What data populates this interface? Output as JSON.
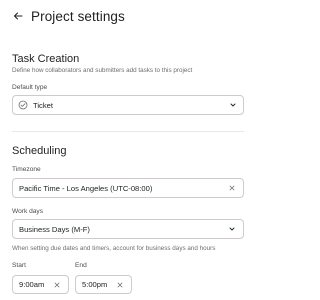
{
  "header": {
    "title": "Project settings"
  },
  "task_creation": {
    "title": "Task Creation",
    "description": "Define how collaborators and submitters add tasks to this project",
    "default_type_label": "Default type",
    "default_type_value": "Ticket"
  },
  "scheduling": {
    "title": "Scheduling",
    "timezone_label": "Timezone",
    "timezone_value": "Pacific Time - Los Angeles (UTC-08:00)",
    "workdays_label": "Work days",
    "workdays_value": "Business Days (M-F)",
    "workdays_hint": "When setting due dates and timers, account for business days and hours",
    "start_label": "Start",
    "start_value": "9:00am",
    "end_label": "End",
    "end_value": "5:00pm"
  },
  "colors": {
    "text": "#1e1f21",
    "muted": "#6d6e6f",
    "border": "#cfcbcb"
  },
  "icons": {
    "back": "arrow-left-icon",
    "ticket": "check-circle-icon",
    "dropdown": "chevron-down-icon",
    "clear": "close-icon"
  }
}
